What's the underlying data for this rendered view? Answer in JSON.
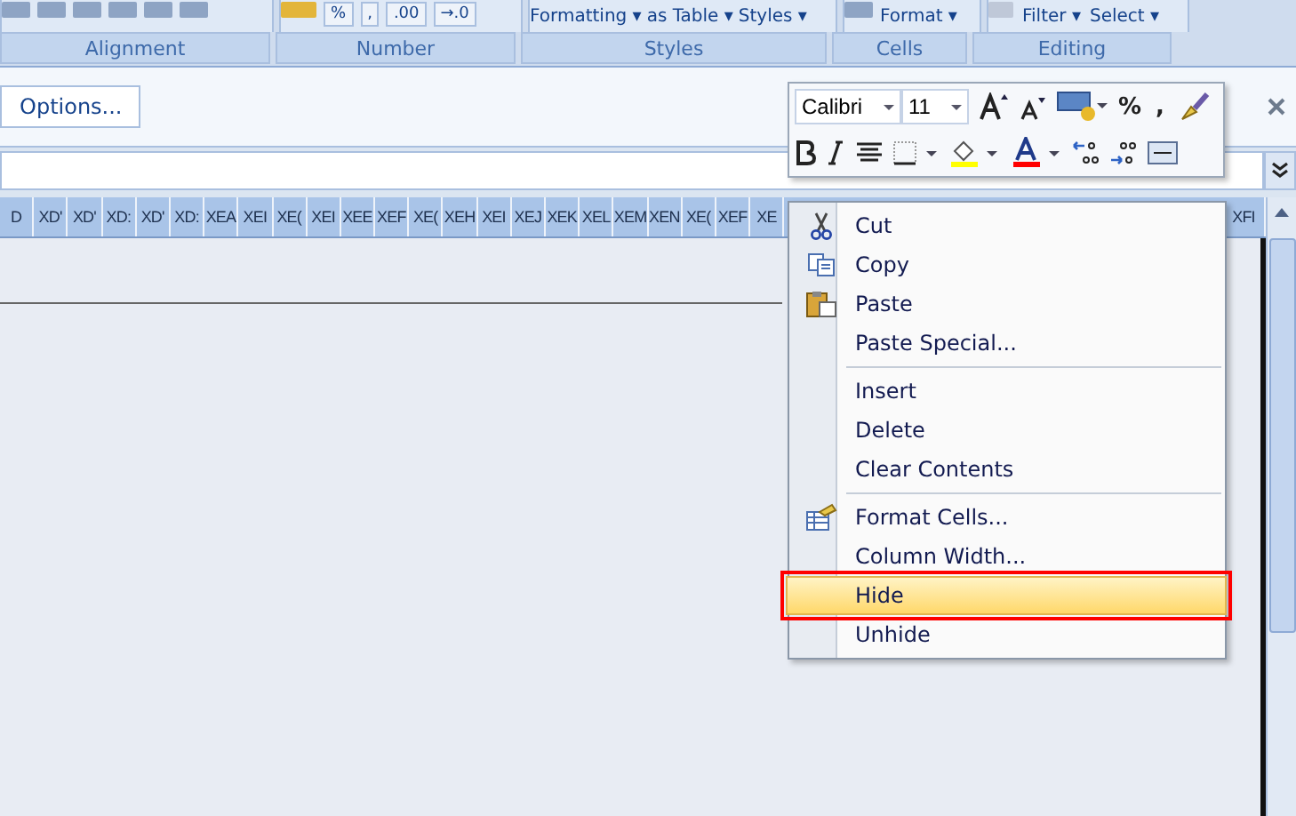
{
  "ribbon": {
    "buttons": [
      {
        "label": "Formatting ▾"
      },
      {
        "label": "as Table ▾"
      },
      {
        "label": "Styles ▾"
      },
      {
        "label": "Format ▾"
      },
      {
        "label": "Filter ▾"
      },
      {
        "label": "Select ▾"
      }
    ],
    "groups": [
      {
        "label": "Alignment"
      },
      {
        "label": "Number"
      },
      {
        "label": "Styles"
      },
      {
        "label": "Cells"
      },
      {
        "label": "Editing"
      }
    ],
    "number_buttons": [
      {
        "label": "%"
      },
      {
        "label": ","
      },
      {
        "label": ".00"
      },
      {
        "label": "→.0"
      }
    ]
  },
  "message_bar": {
    "button": "Options..."
  },
  "column_headers": [
    "D",
    "XD'",
    "XD'",
    "XD:",
    "XD'",
    "XD:",
    "XEA",
    "XEI",
    "XE(",
    "XEI",
    "XEE",
    "XEF",
    "XE(",
    "XEH",
    "XEI",
    "XEJ",
    "XEK",
    "XEL",
    "XEM",
    "XEN",
    "XE(",
    "XEF",
    "XE"
  ],
  "last_column_header": "XFI",
  "mini_toolbar": {
    "font": "Calibri",
    "size": "11",
    "percent": "%",
    "comma": ","
  },
  "context_menu": [
    {
      "kind": "cut",
      "label": "Cut",
      "selected": false,
      "outlined": false
    },
    {
      "kind": "copy",
      "label": "Copy",
      "selected": false,
      "outlined": false
    },
    {
      "kind": "paste",
      "label": "Paste",
      "selected": false,
      "outlined": false
    },
    {
      "kind": "item",
      "label": "Paste Special...",
      "selected": false,
      "outlined": false
    },
    {
      "kind": "separator"
    },
    {
      "kind": "item",
      "label": "Insert",
      "selected": false,
      "outlined": false
    },
    {
      "kind": "item",
      "label": "Delete",
      "selected": false,
      "outlined": false
    },
    {
      "kind": "item",
      "label": "Clear Contents",
      "selected": false,
      "outlined": false
    },
    {
      "kind": "separator"
    },
    {
      "kind": "format",
      "label": "Format Cells...",
      "selected": false,
      "outlined": false
    },
    {
      "kind": "item",
      "label": "Column Width...",
      "selected": false,
      "outlined": false
    },
    {
      "kind": "item",
      "label": "Hide",
      "selected": true,
      "outlined": true
    },
    {
      "kind": "item",
      "label": "Unhide",
      "selected": false,
      "outlined": false
    }
  ]
}
